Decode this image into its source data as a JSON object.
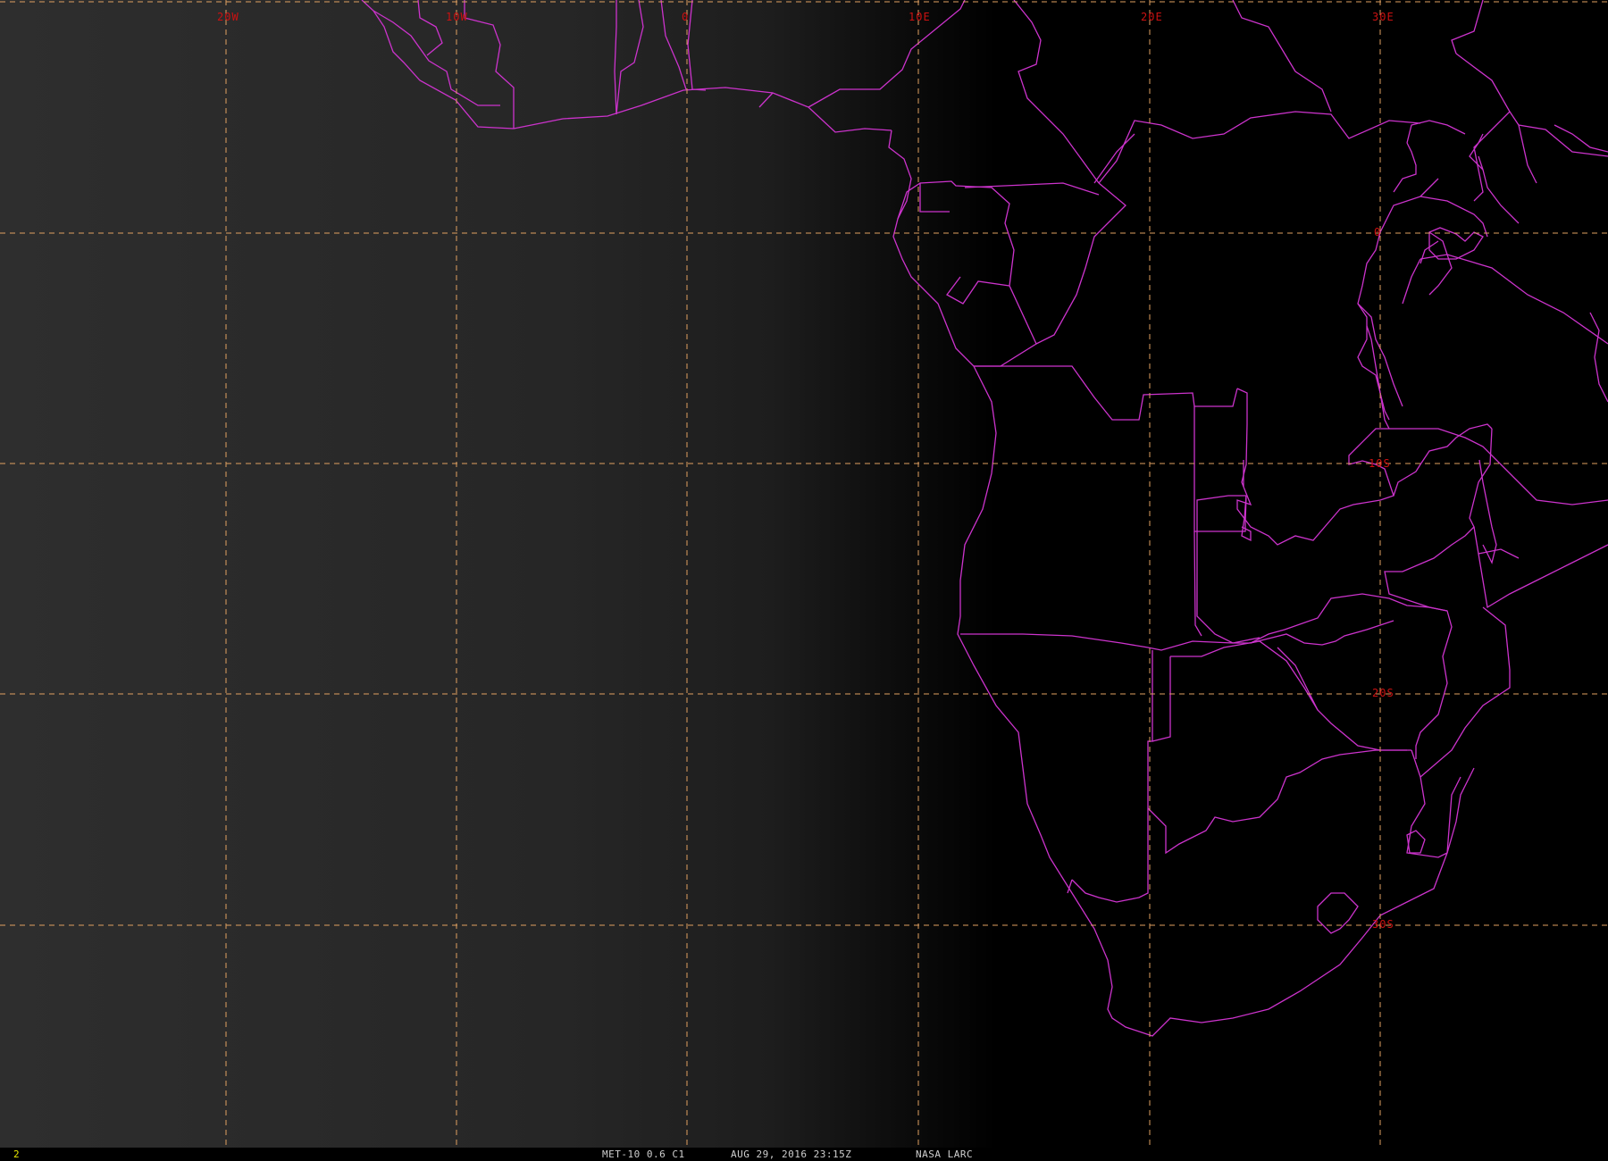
{
  "image": {
    "satellite_label": "MET-10 0.6 C1",
    "datetime_label": "AUG 29, 2016 23:15Z",
    "source_label": "NASA LARC",
    "frame_number": "2"
  },
  "grid": {
    "longitude_labels": [
      "20W",
      "10W",
      "0",
      "10E",
      "20E",
      "30E"
    ],
    "latitude_labels": [
      "0",
      "10S",
      "20S",
      "30S"
    ],
    "line_style": "dashed",
    "line_color": "#e0a060",
    "label_color": "#cc1111"
  },
  "map": {
    "region": "Southern and Central Africa / South Atlantic",
    "boundary_color": "#cc33cc",
    "background_color": "#000000"
  },
  "colors": {
    "frame_number": "#e8e800",
    "status_text": "#cfcfcf"
  }
}
